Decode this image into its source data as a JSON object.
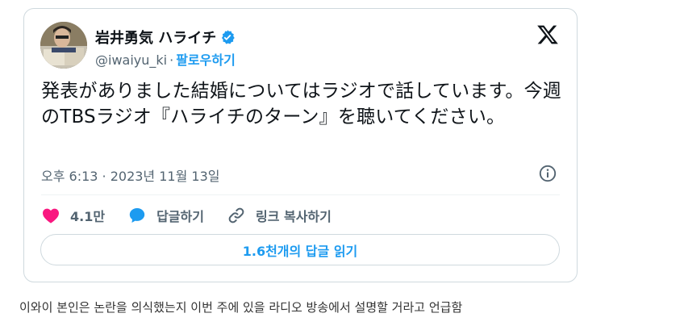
{
  "author": {
    "display_name": "岩井勇気 ハライチ",
    "handle": "@iwaiyu_ki",
    "separator": "·",
    "follow_label": "팔로우하기",
    "verified": true
  },
  "tweet": {
    "text": "発表がありました結婚についてはラジオで話しています。今週のTBSラジオ『ハライチのターン』を聴いてください。",
    "timestamp": "오후 6:13 · 2023년 11월 13일"
  },
  "actions": {
    "like_count": "4.1만",
    "reply_label": "답글하기",
    "copy_link_label": "링크 복사하기"
  },
  "read_replies_label": "1.6천개의 답글 읽기",
  "caption": "이와이 본인은 논란을 의식했는지 이번 주에 있을 라디오 방송에서 설명할 거라고 언급함",
  "colors": {
    "accent": "#1d9bf0",
    "like": "#f91880",
    "text": "#0f1419",
    "muted": "#536471"
  }
}
